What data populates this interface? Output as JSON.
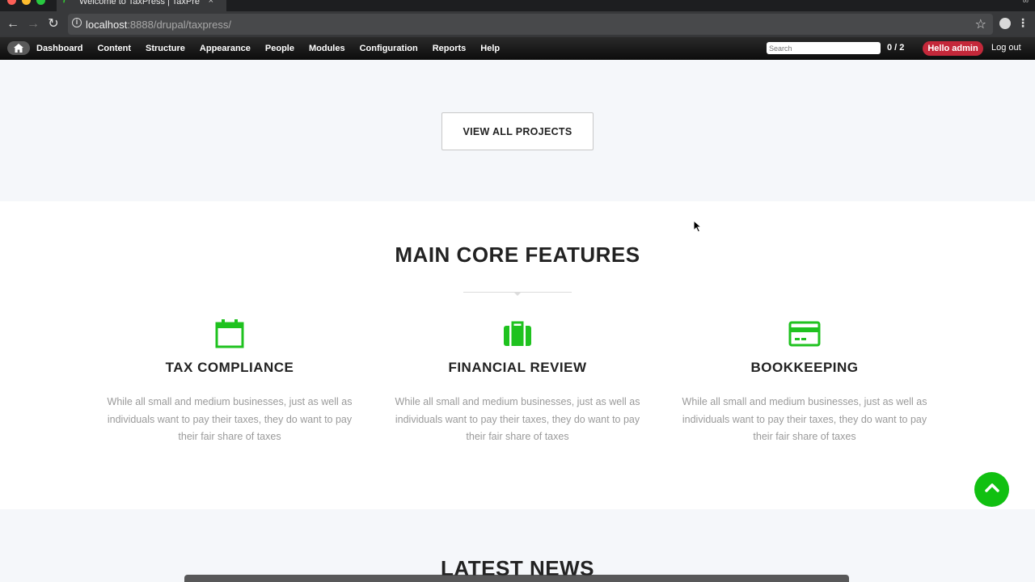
{
  "browser": {
    "tab_title": "Welcome to TaxPress | TaxPre",
    "tab_close": "×",
    "url_host": "localhost",
    "url_rest": ":8888/drupal/taxpress/",
    "profile": "∞"
  },
  "adminbar": {
    "home_icon": "home-icon",
    "menu": [
      "Dashboard",
      "Content",
      "Structure",
      "Appearance",
      "People",
      "Modules",
      "Configuration",
      "Reports",
      "Help"
    ],
    "search_placeholder": "Search",
    "user_count": "0 / 2",
    "hello": "Hello admin",
    "logout": "Log out"
  },
  "projects": {
    "view_all": "VIEW ALL PROJECTS"
  },
  "features": {
    "title": "MAIN CORE FEATURES",
    "accent_color": "#1fc21f",
    "items": [
      {
        "icon": "calendar-icon",
        "title": "TAX COMPLIANCE",
        "text": "While all small and medium businesses, just as well as individuals want to pay their taxes, they do want to pay their fair share of taxes"
      },
      {
        "icon": "briefcase-icon",
        "title": "FINANCIAL REVIEW",
        "text": "While all small and medium businesses, just as well as individuals want to pay their taxes, they do want to pay their fair share of taxes"
      },
      {
        "icon": "credit-card-icon",
        "title": "BOOKKEEPING",
        "text": "While all small and medium businesses, just as well as individuals want to pay their taxes, they do want to pay their fair share of taxes"
      }
    ]
  },
  "news": {
    "title": "LATEST NEWS"
  }
}
